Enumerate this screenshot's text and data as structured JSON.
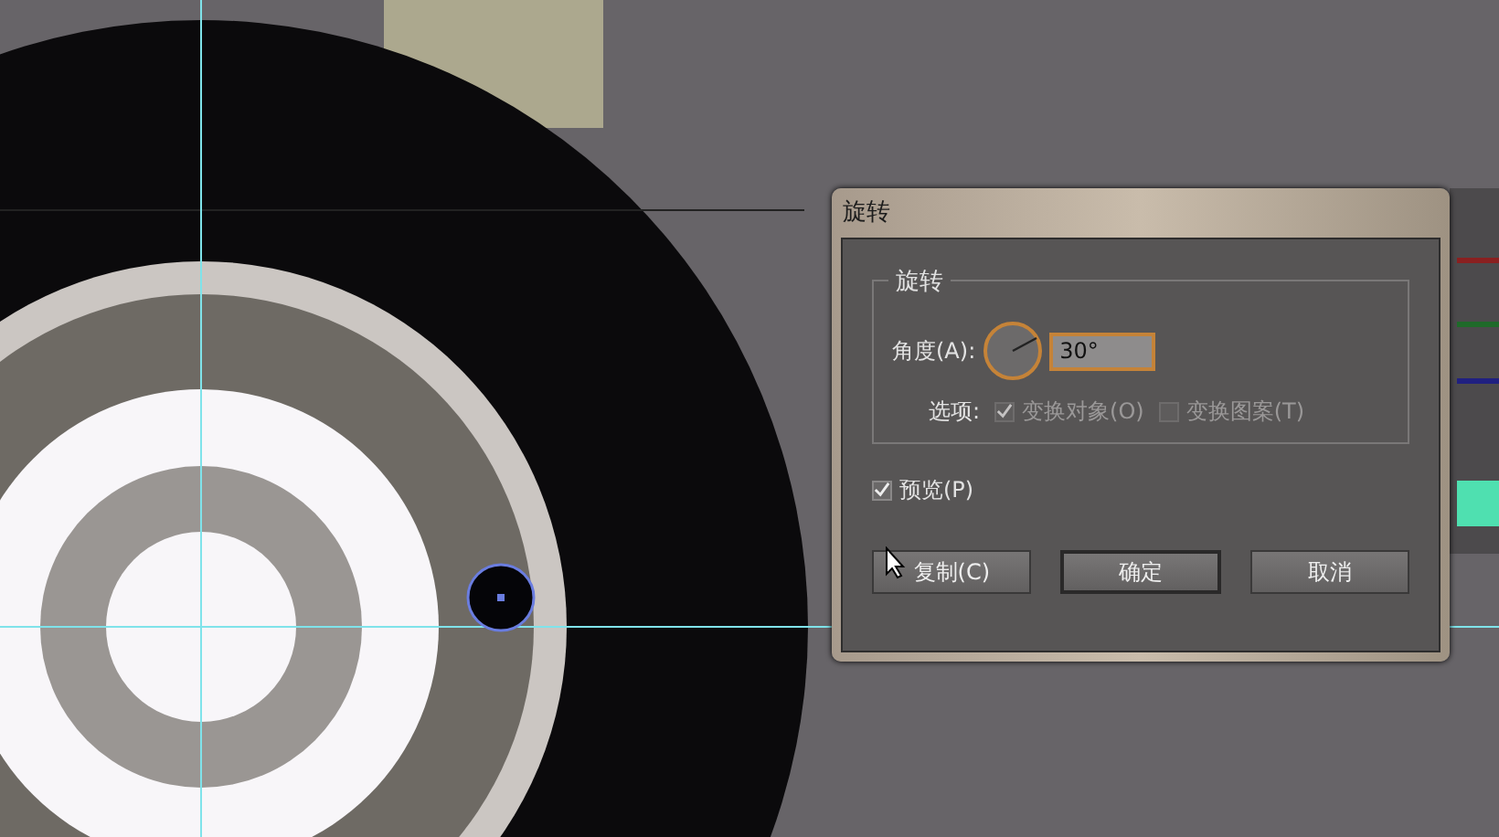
{
  "dialog": {
    "title": "旋转",
    "group_title": "旋转",
    "angle": {
      "label": "角度(A):",
      "value": "30°"
    },
    "options": {
      "label": "选项:",
      "items": [
        {
          "label": "变换对象(O)",
          "checked": true,
          "disabled": true
        },
        {
          "label": "变换图案(T)",
          "checked": false,
          "disabled": true
        }
      ]
    },
    "preview": {
      "label": "预览(P)",
      "checked": true
    },
    "buttons": [
      {
        "label": "复制(C)",
        "default": false
      },
      {
        "label": "确定",
        "default": true
      },
      {
        "label": "取消",
        "default": false
      }
    ]
  }
}
